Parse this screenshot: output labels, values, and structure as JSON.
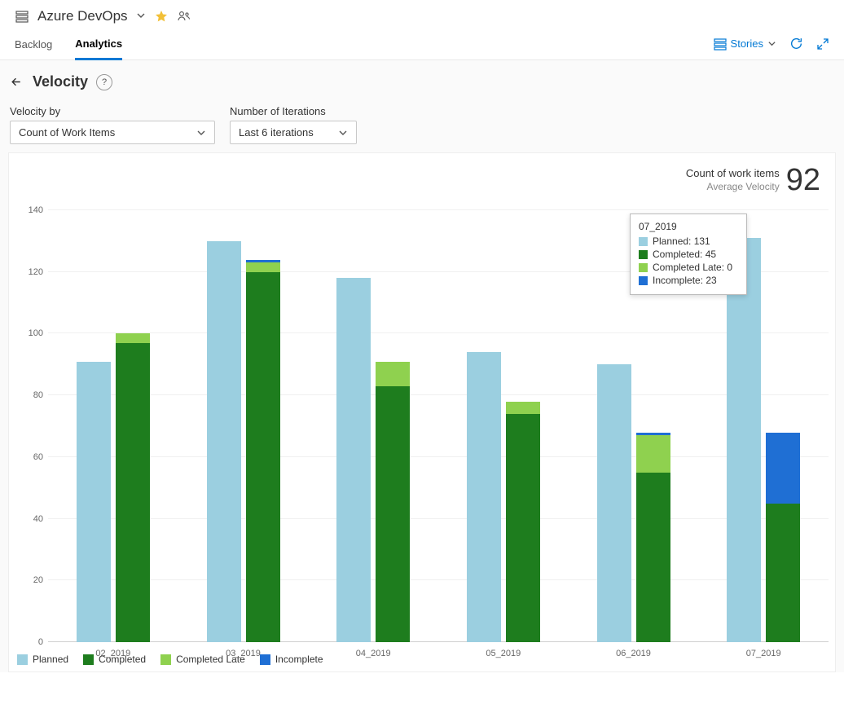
{
  "header": {
    "workspace": "Azure DevOps"
  },
  "tabs": {
    "backlog": "Backlog",
    "analytics": "Analytics"
  },
  "toolbar": {
    "stories_label": "Stories"
  },
  "page": {
    "title": "Velocity"
  },
  "filters": {
    "velocity_by_label": "Velocity by",
    "velocity_by_value": "Count of Work Items",
    "iterations_label": "Number of Iterations",
    "iterations_value": "Last 6 iterations"
  },
  "summary": {
    "line1": "Count of work items",
    "line2": "Average Velocity",
    "value": "92"
  },
  "tooltip": {
    "title": "07_2019",
    "rows": [
      {
        "label": "Planned: 131",
        "color": "#9bcfe0"
      },
      {
        "label": "Completed: 45",
        "color": "#1e7d1e"
      },
      {
        "label": "Completed Late: 0",
        "color": "#8fd14f"
      },
      {
        "label": "Incomplete: 23",
        "color": "#1f6fd4"
      }
    ]
  },
  "legend": [
    {
      "label": "Planned",
      "color": "#9bcfe0"
    },
    {
      "label": "Completed",
      "color": "#1e7d1e"
    },
    {
      "label": "Completed Late",
      "color": "#8fd14f"
    },
    {
      "label": "Incomplete",
      "color": "#1f6fd4"
    }
  ],
  "chart_data": {
    "type": "bar",
    "title": "Velocity",
    "xlabel": "",
    "ylabel": "",
    "ylim": [
      0,
      140
    ],
    "yticks": [
      0,
      20,
      40,
      60,
      80,
      100,
      120,
      140
    ],
    "categories": [
      "02_2019",
      "03_2019",
      "04_2019",
      "05_2019",
      "06_2019",
      "07_2019"
    ],
    "series": [
      {
        "name": "Planned",
        "color": "#9bcfe0",
        "values": [
          91,
          130,
          118,
          94,
          90,
          131
        ]
      },
      {
        "name": "Completed",
        "color": "#1e7d1e",
        "values": [
          97,
          120,
          83,
          74,
          55,
          45
        ]
      },
      {
        "name": "Completed Late",
        "color": "#8fd14f",
        "values": [
          3,
          3,
          8,
          4,
          12,
          0
        ]
      },
      {
        "name": "Incomplete",
        "color": "#1f6fd4",
        "values": [
          0,
          1,
          0,
          0,
          1,
          23
        ]
      }
    ],
    "note": "Second bar per category is stacked: Completed + Completed Late + Incomplete"
  }
}
